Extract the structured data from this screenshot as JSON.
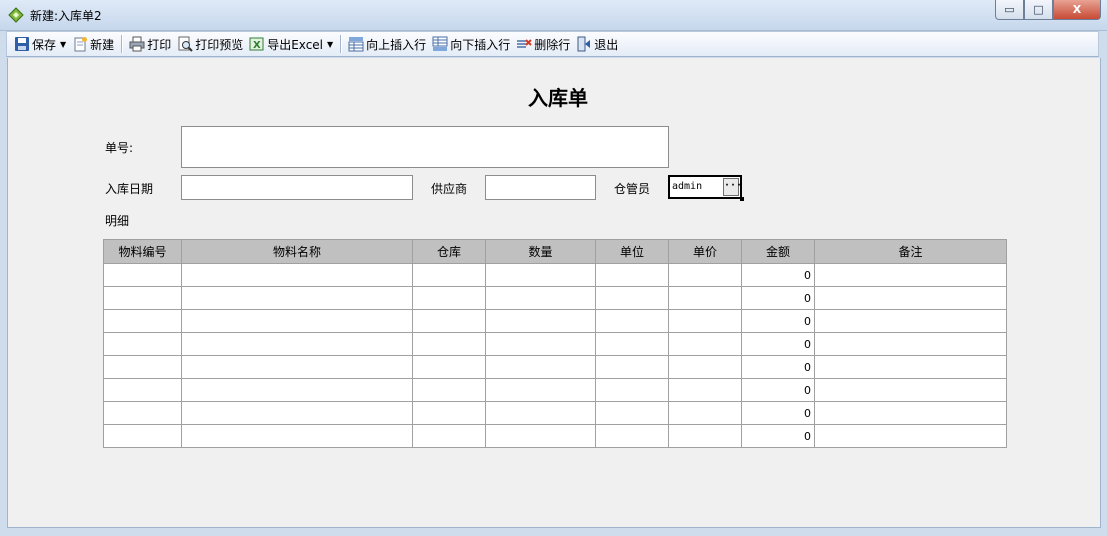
{
  "window": {
    "title": "新建:入库单2",
    "min_label": "▭",
    "max_label": "□",
    "close_label": "X"
  },
  "toolbar": {
    "save": "保存",
    "new": "新建",
    "print": "打印",
    "print_preview": "打印预览",
    "export_excel": "导出Excel",
    "insert_above": "向上插入行",
    "insert_below": "向下插入行",
    "delete_row": "删除行",
    "exit": "退出",
    "dropdown_glyph": "▼"
  },
  "form": {
    "title": "入库单",
    "order_no_label": "单号:",
    "order_no_value": "",
    "date_label": "入库日期",
    "date_value": "",
    "supplier_label": "供应商",
    "supplier_value": "",
    "keeper_label": "仓管员",
    "keeper_value": "admin",
    "keeper_button": "···",
    "detail_label": "明细"
  },
  "grid": {
    "columns": [
      "物料编号",
      "物料名称",
      "仓库",
      "数量",
      "单位",
      "单价",
      "金额",
      "备注"
    ],
    "rows": [
      [
        "",
        "",
        "",
        "",
        "",
        "",
        "0",
        ""
      ],
      [
        "",
        "",
        "",
        "",
        "",
        "",
        "0",
        ""
      ],
      [
        "",
        "",
        "",
        "",
        "",
        "",
        "0",
        ""
      ],
      [
        "",
        "",
        "",
        "",
        "",
        "",
        "0",
        ""
      ],
      [
        "",
        "",
        "",
        "",
        "",
        "",
        "0",
        ""
      ],
      [
        "",
        "",
        "",
        "",
        "",
        "",
        "0",
        ""
      ],
      [
        "",
        "",
        "",
        "",
        "",
        "",
        "0",
        ""
      ],
      [
        "",
        "",
        "",
        "",
        "",
        "",
        "0",
        ""
      ]
    ]
  },
  "colors": {
    "accent": "#2f5fa6",
    "grid_header": "#c0c0c0",
    "client_bg": "#f0f0f0"
  }
}
